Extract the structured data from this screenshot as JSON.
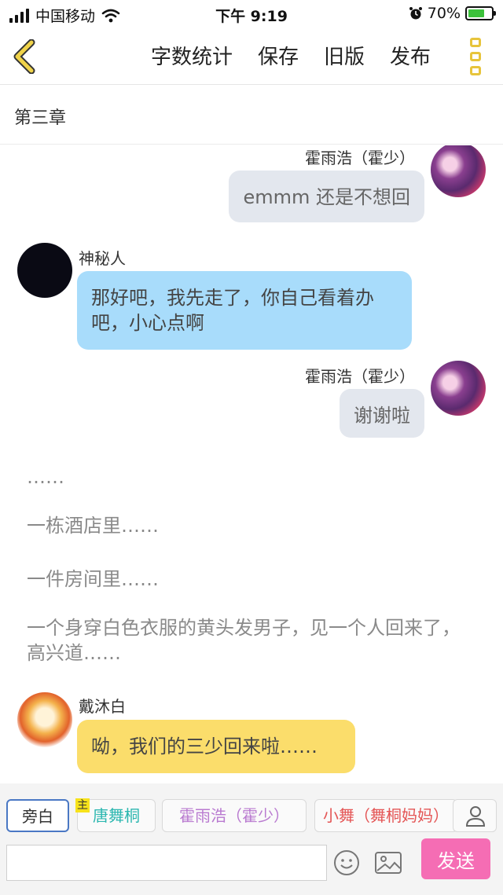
{
  "status_bar": {
    "carrier": "中国移动",
    "time": "下午 9:19",
    "battery": "70%",
    "battery_level": 0.7
  },
  "nav": {
    "back_icon": "chevron-left-icon",
    "word_count": "字数统计",
    "save": "保存",
    "old_version": "旧版",
    "publish": "发布",
    "menu_icon": "more-vertical-icon"
  },
  "chapter": {
    "title": "第三章"
  },
  "messages": [
    {
      "speaker": "霍雨浩（霍少）",
      "text": "emmm 还是不想回",
      "side": "right",
      "color": "#e3e7ee"
    },
    {
      "speaker": "神秘人",
      "text": "那好吧，我先走了，你自己看着办吧，小心点啊",
      "side": "left",
      "color": "#a8dcfb"
    },
    {
      "speaker": "霍雨浩（霍少）",
      "text": "谢谢啦",
      "side": "right",
      "color": "#e3e7ee"
    },
    {
      "speaker": "戴沐白",
      "text": "呦，我们的三少回来啦……",
      "side": "left",
      "color": "#fbdd6b"
    }
  ],
  "narration": [
    "……",
    "一栋酒店里……",
    "一件房间里……",
    "一个身穿白色衣服的黄头发男子，见一个人回来了，高兴道……"
  ],
  "roles": {
    "narrator": "旁白",
    "main_tag": "主",
    "tang": "唐舞桐",
    "huo": "霍雨浩（霍少）",
    "xiaowu": "小舞（舞桐妈妈）",
    "person_icon": "person-icon"
  },
  "composer": {
    "input_value": "",
    "emoji_icon": "emoji-icon",
    "image_icon": "image-icon",
    "send": "发送"
  }
}
